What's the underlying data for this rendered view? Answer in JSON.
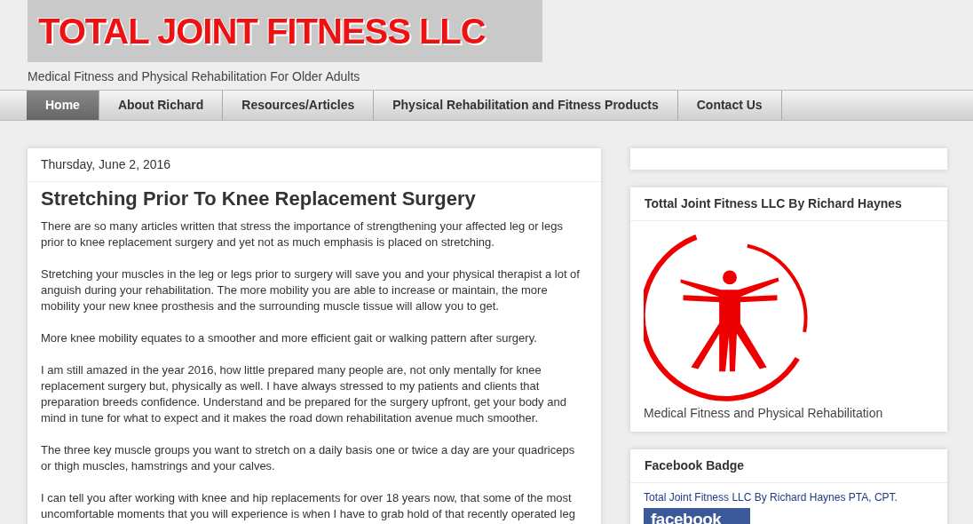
{
  "header": {
    "logo_text": "TOTAL JOINT FITNESS LLC",
    "description": "Medical Fitness and Physical Rehabilitation For Older Adults"
  },
  "nav": [
    {
      "label": "Home",
      "selected": true
    },
    {
      "label": "About Richard",
      "selected": false
    },
    {
      "label": "Resources/Articles",
      "selected": false
    },
    {
      "label": "Physical Rehabilitation and Fitness Products",
      "selected": false
    },
    {
      "label": "Contact Us",
      "selected": false
    }
  ],
  "post": {
    "date": "Thursday, June 2, 2016",
    "title": "Stretching Prior To Knee Replacement Surgery",
    "paragraphs": [
      "There are so many articles written that stress the importance of strengthening your affected leg or legs prior to knee replacement surgery and yet not as much emphasis is placed on stretching.",
      "Stretching your muscles in the leg or legs prior to surgery will save you and your physical therapist a lot of anguish during your rehabilitation. The more mobility you are able to increase or maintain, the more mobility your new knee prosthesis and the surrounding muscle tissue will allow you to get.",
      "More knee mobility equates to a smoother and more efficient gait or walking pattern after surgery.",
      "I am still amazed in the year 2016, how little prepared many people are, not only mentally for knee replacement surgery but, physically as well. I have always stressed to my patients and clients that preparation breeds confidence. Understand and be prepared for the surgery upfront, get your body and mind in tune for what to expect and it makes the road down rehabilitation avenue much smoother.",
      "The three key muscle groups you want to stretch on a daily basis one or twice a day are your quadriceps or thigh muscles, hamstrings and your calves.",
      "I can tell you after working with knee and hip replacements for over 18 years now, that some of the most uncomfortable moments that you will experience is when I have to grab hold of that recently operated leg"
    ]
  },
  "sidebar": [
    {
      "kind": "empty"
    },
    {
      "kind": "logo",
      "title": "Tottal Joint Fitness LLC By Richard Haynes",
      "caption": "Medical Fitness and Physical Rehabilitation"
    },
    {
      "kind": "facebook",
      "title": "Facebook Badge",
      "link": "Total Joint Fitness LLC By Richard Haynes PTA, CPT.",
      "badge": "facebook"
    }
  ]
}
